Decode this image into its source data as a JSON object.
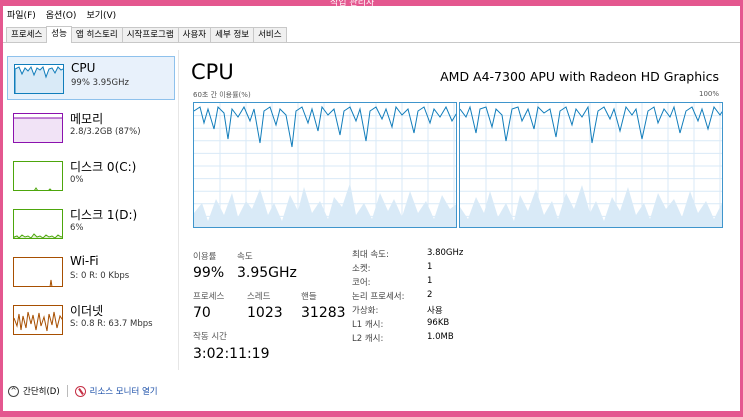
{
  "window": {
    "title": "작업 관리자"
  },
  "menu": [
    "파일(F)",
    "옵션(O)",
    "보기(V)"
  ],
  "tabs": [
    {
      "label": "프로세스",
      "active": false
    },
    {
      "label": "성능",
      "active": true
    },
    {
      "label": "앱 히스토리",
      "active": false
    },
    {
      "label": "시작프로그램",
      "active": false
    },
    {
      "label": "사용자",
      "active": false
    },
    {
      "label": "세부 정보",
      "active": false
    },
    {
      "label": "서비스",
      "active": false
    }
  ],
  "sidebar": [
    {
      "title": "CPU",
      "sub": "99% 3.95GHz",
      "color": "#117dbb"
    },
    {
      "title": "메모리",
      "sub": "2.8/3.2GB (87%)",
      "color": "#8b12ae"
    },
    {
      "title": "디스크 0(C:)",
      "sub": "0%",
      "color": "#4da60c"
    },
    {
      "title": "디스크 1(D:)",
      "sub": "6%",
      "color": "#4da60c"
    },
    {
      "title": "Wi-Fi",
      "sub": "S: 0 R: 0 Kbps",
      "color": "#a74f01"
    },
    {
      "title": "이더넷",
      "sub": "S: 0.8 R: 63.7 Mbps",
      "color": "#a74f01"
    }
  ],
  "main": {
    "title": "CPU",
    "model": "AMD A4-7300 APU with Radeon HD Graphics",
    "axis_left": "60초 간 이용률(%)",
    "axis_right": "100%",
    "graph_color": "#117dbb",
    "utilization_label": "이용률",
    "utilization": "99%",
    "speed_label": "속도",
    "speed": "3.95GHz",
    "processes_label": "프로세스",
    "processes": "70",
    "threads_label": "스레드",
    "threads": "1023",
    "handles_label": "핸들",
    "handles": "31283",
    "uptime_label": "작동 시간",
    "uptime": "3:02:11:19",
    "info": [
      {
        "label": "최대 속도:",
        "value": "3.80GHz"
      },
      {
        "label": "소켓:",
        "value": "1"
      },
      {
        "label": "코어:",
        "value": "1"
      },
      {
        "label": "논리 프로세서:",
        "value": "2"
      },
      {
        "label": "가상화:",
        "value": "사용"
      },
      {
        "label": "L1 캐시:",
        "value": "96KB"
      },
      {
        "label": "L2 캐시:",
        "value": "1.0MB"
      }
    ]
  },
  "bottom": {
    "collapse": "간단히(D)",
    "resource_monitor": "리소스 모니터 열기"
  }
}
